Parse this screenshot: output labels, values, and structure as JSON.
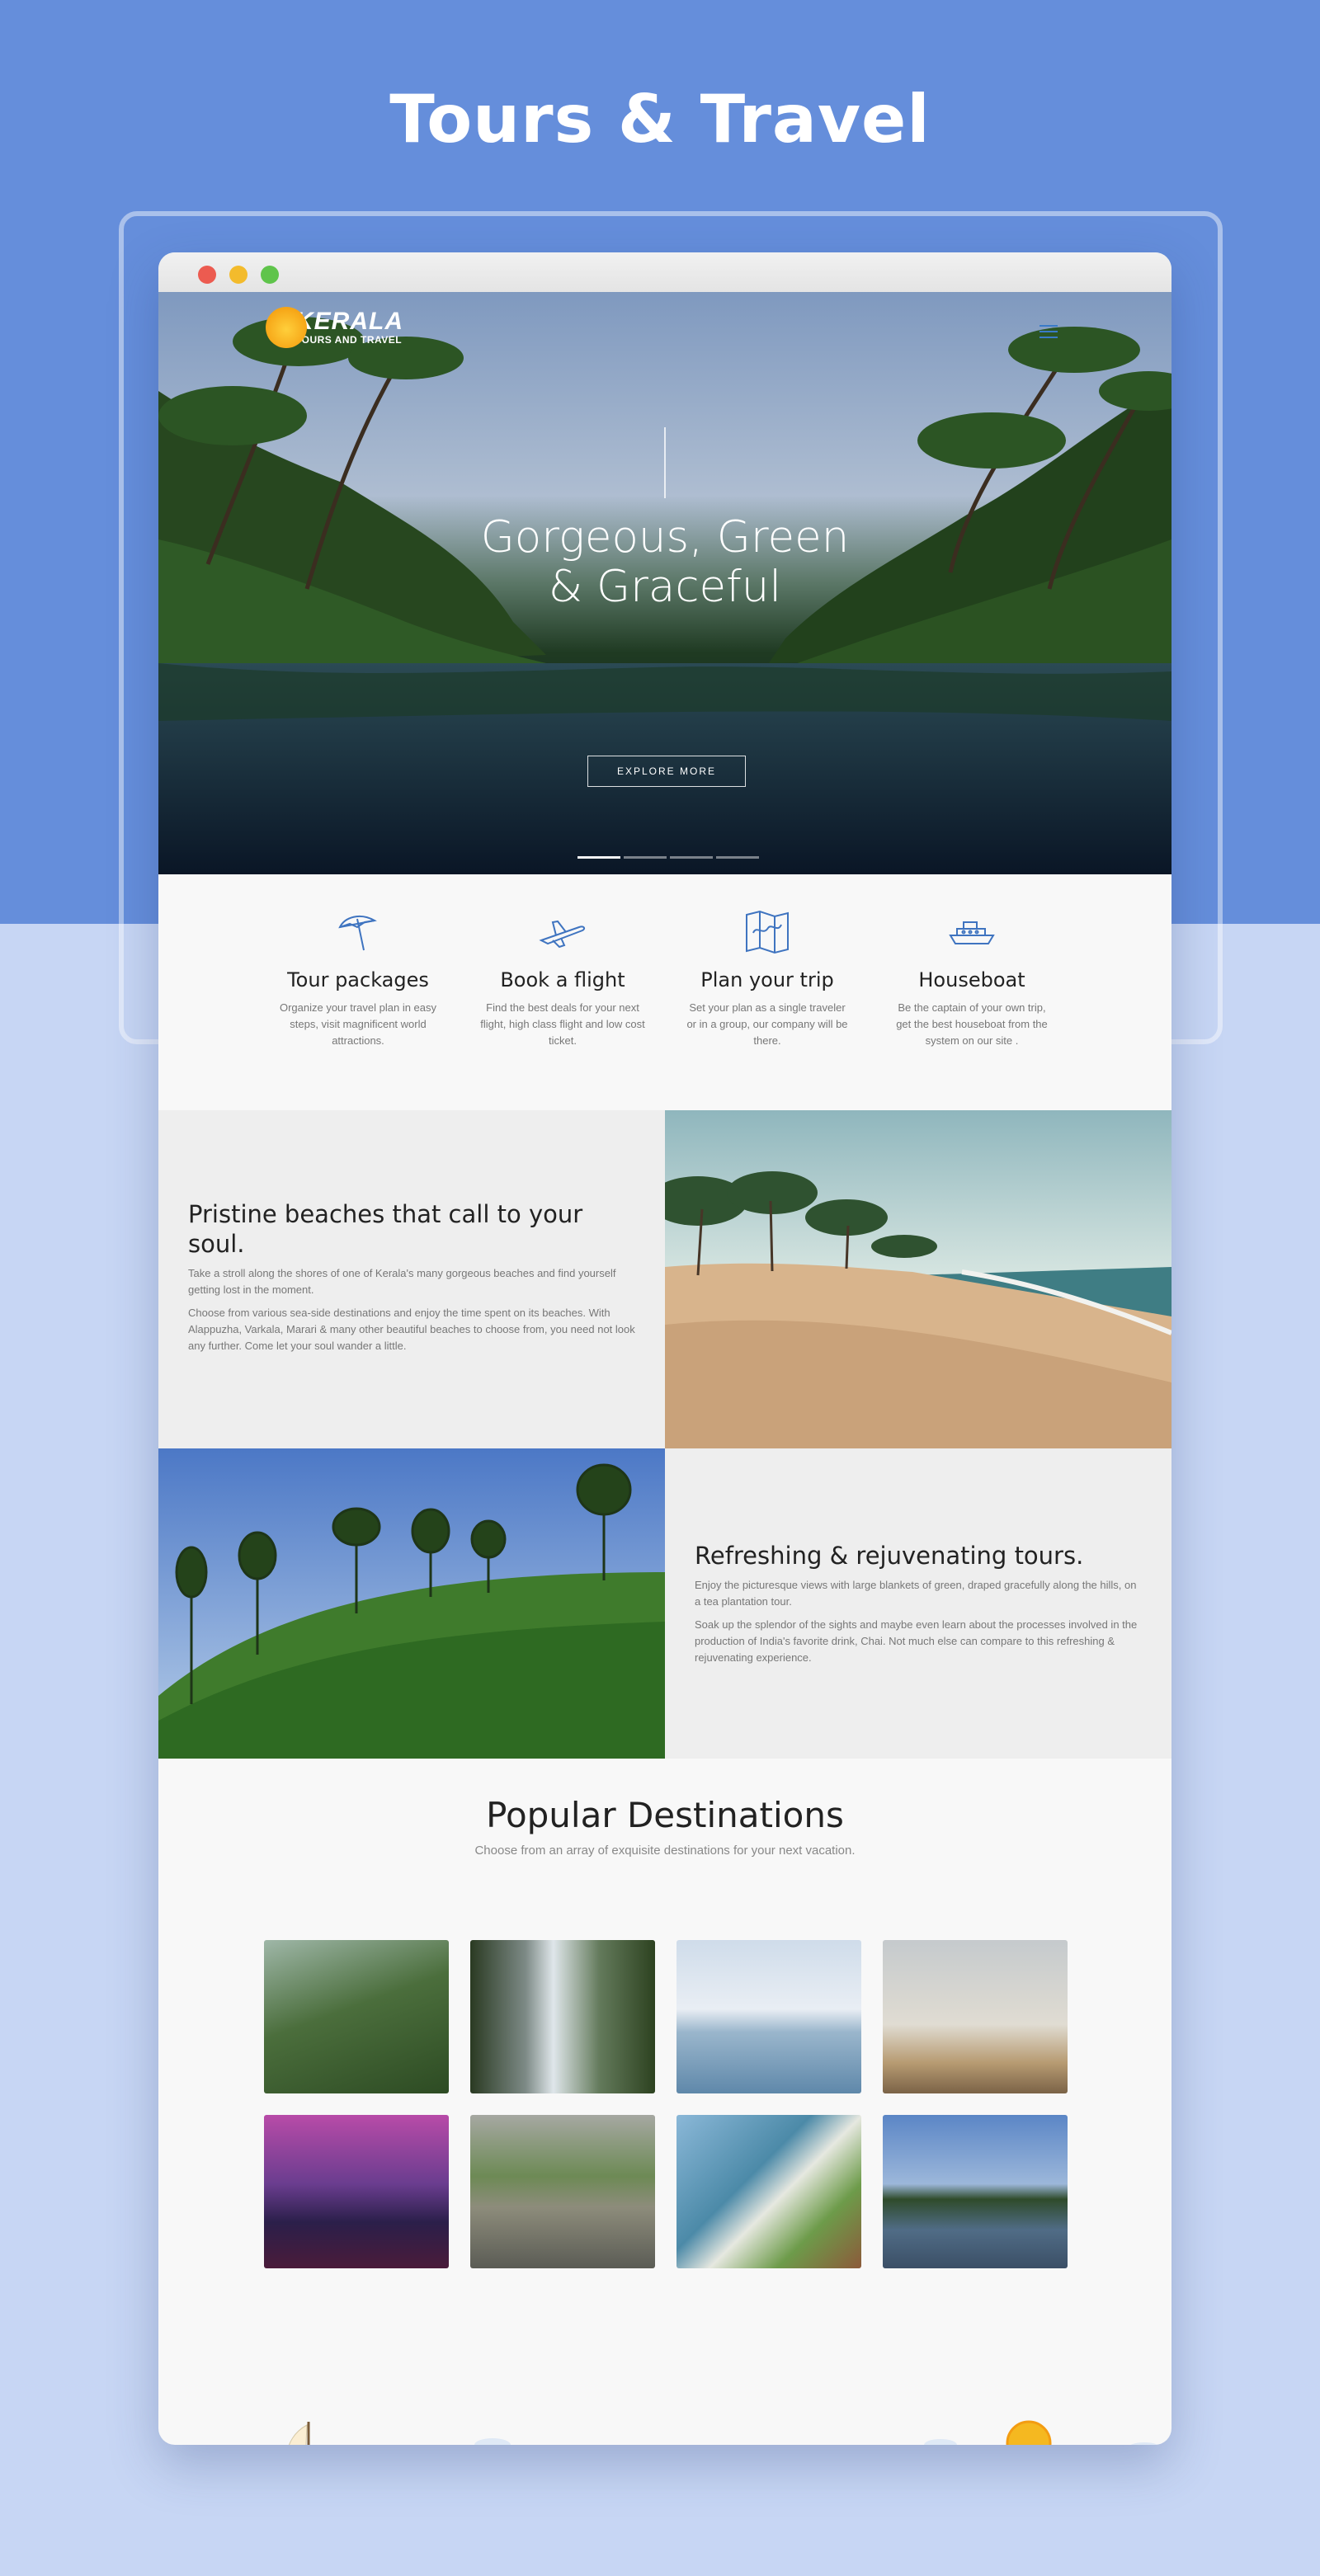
{
  "page": {
    "title": "Tours & Travel"
  },
  "colors": {
    "accent": "#658edb",
    "background": "#c7d6f4",
    "icon": "#3f74c0",
    "sea": "#a6ebe2"
  },
  "window": {
    "controls": [
      "close",
      "minimize",
      "maximize"
    ]
  },
  "site": {
    "logo": {
      "name": "KERALA",
      "tagline": "TOURS AND TRAVEL"
    },
    "hero": {
      "line1": "Gorgeous, Green",
      "line2": "& Graceful",
      "button": "EXPLORE MORE",
      "slides": 4,
      "active_slide": 1
    },
    "features": [
      {
        "icon": "umbrella-icon",
        "title": "Tour packages",
        "text": "Organize your travel plan in easy steps, visit magnificent world attractions."
      },
      {
        "icon": "airplane-icon",
        "title": "Book a flight",
        "text": "Find the best deals for your next flight, high class flight and low cost ticket."
      },
      {
        "icon": "map-icon",
        "title": "Plan your trip",
        "text": "Set your plan as a single traveler or in a group, our company will be there."
      },
      {
        "icon": "boat-icon",
        "title": "Houseboat",
        "text": "Be the captain of your own trip, get the best houseboat from the system on our site ."
      }
    ],
    "beaches": {
      "title": "Pristine beaches that call to your soul.",
      "p1": "Take a stroll along the shores of one of Kerala's many gorgeous beaches and find yourself getting lost in the moment.",
      "p2": "Choose from various sea-side destinations and enjoy the time spent on its beaches. With Alappuzha, Varkala, Marari & many other beautiful beaches to choose from, you need not look any further. Come let your soul wander a little."
    },
    "tours": {
      "title": "Refreshing & rejuvenating tours.",
      "p1": "Enjoy the picturesque views with large blankets of green, draped gracefully along the hills, on a tea plantation tour.",
      "p2": "Soak up the splendor of the sights and maybe even learn about the processes involved in the production of  India's favorite drink, Chai. Not much else can compare to this refreshing & rejuvenating experience."
    },
    "destinations": {
      "title": "Popular Destinations",
      "subtitle": "Choose from an array of exquisite destinations for your next vacation."
    }
  }
}
